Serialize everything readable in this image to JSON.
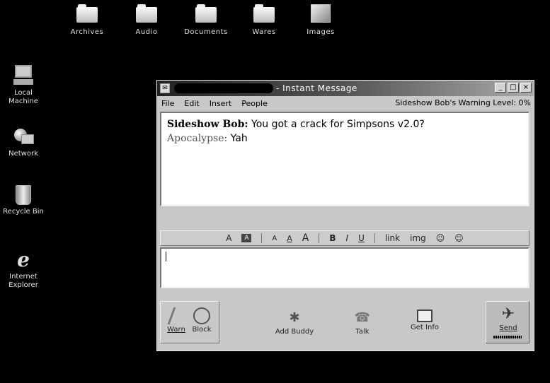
{
  "desktop": {
    "top_icons": [
      {
        "label": "Archives",
        "icon": "folder-icon"
      },
      {
        "label": "Audio",
        "icon": "folder-icon"
      },
      {
        "label": "Documents",
        "icon": "folder-icon"
      },
      {
        "label": "Wares",
        "icon": "folder-icon"
      },
      {
        "label": "Images",
        "icon": "image-folder-icon"
      }
    ],
    "left_icons": [
      {
        "label_1": "Local",
        "label_2": "Machine",
        "icon": "computer-icon"
      },
      {
        "label_1": "Network",
        "label_2": "",
        "icon": "network-icon"
      },
      {
        "label_1": "Recycle Bin",
        "label_2": "",
        "icon": "recycle-bin-icon"
      },
      {
        "label_1": "Internet",
        "label_2": "Explorer",
        "icon": "internet-explorer-icon"
      }
    ]
  },
  "window": {
    "title": "- Instant Message",
    "controls": {
      "minimize": "_",
      "maximize": "□",
      "close": "×"
    },
    "menu": [
      "File",
      "Edit",
      "Insert",
      "People"
    ],
    "warning_level": "Sideshow Bob's Warning Level: 0%",
    "conversation": [
      {
        "sender": "Sideshow Bob:",
        "text": " You got a crack for Simpsons v2.0?"
      },
      {
        "sender": "Apocalypse:",
        "text": " Yah"
      }
    ],
    "format_bar": [
      "A",
      "A",
      "A",
      "A",
      "A",
      "B",
      "I",
      "U",
      "link",
      "img",
      "☺",
      "☺"
    ],
    "input_value": "",
    "buttons": {
      "warn": "Warn",
      "block": "Block",
      "add_buddy": "Add Buddy",
      "talk": "Talk",
      "get_info": "Get Info",
      "send": "Send"
    }
  }
}
